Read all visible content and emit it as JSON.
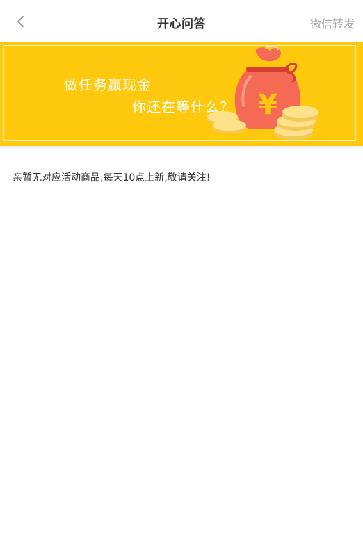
{
  "nav": {
    "title": "开心问答",
    "share_label": "微信转发"
  },
  "banner": {
    "line1": "做任务赢现金",
    "line2": "你还在等什么?",
    "bag_symbol": "¥"
  },
  "content": {
    "empty_message": "亲暂无对应活动商品,每天10点上新,敬请关注!"
  },
  "colors": {
    "banner_bg": "#fec90c",
    "bag": "#f56a55",
    "coin": "#fde28a"
  }
}
